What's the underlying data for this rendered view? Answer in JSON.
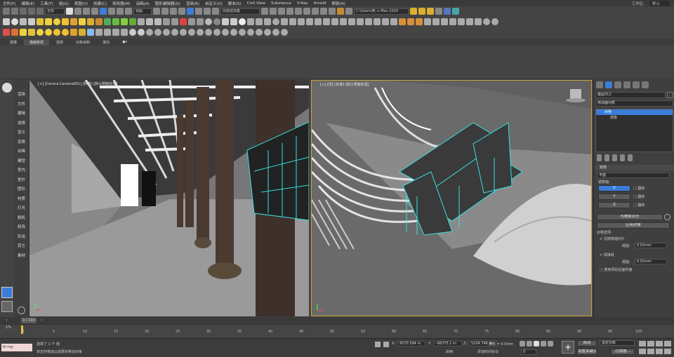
{
  "menubar": {
    "items": [
      "文件(F)",
      "编辑(E)",
      "工具(T)",
      "组(G)",
      "视图(V)",
      "创建(C)",
      "修改器(M)",
      "动画(A)",
      "图形编辑器(D)",
      "渲染(R)",
      "自定义(U)",
      "脚本(S)",
      "Civil View",
      "Substance",
      "V-Ray",
      "Arnold",
      "帮助(H)"
    ],
    "workspace_label": "工作区:",
    "workspace_value": "默认"
  },
  "toolbar": {
    "filter_value": "全部",
    "view_value": "视图",
    "selection_set_value": "创建选择集",
    "project_path": "C:\\Users\\用--s Max 2024"
  },
  "ribbon": {
    "tabs": [
      "建模",
      "自由形式",
      "选择",
      "对象绘制",
      "填充"
    ],
    "active_tab": 1
  },
  "viewport_left": {
    "label": "[+] [Corona Camera001] [标准] [默认明暗处理]"
  },
  "viewport_right": {
    "label": "[+] [顶] [标准] [默认明暗处理]"
  },
  "command_list": [
    "渲染",
    "文件",
    "编辑",
    "选择",
    "显示",
    "变换",
    "动画",
    "模型",
    "室内",
    "室外",
    "图形",
    "材质",
    "灯光",
    "相机",
    "修改",
    "实用",
    "其它",
    "素材"
  ],
  "command_panel": {
    "object_name": "模型012",
    "modifier_list_label": "修改器列表",
    "stack_items": [
      "对称",
      "镜像"
    ],
    "rollout_title": "镜像",
    "mirror_plane_value": "平面",
    "mirror_axis_label": "镜像轴:",
    "axes": [
      "X",
      "Y",
      "Z"
    ],
    "flip_label": "翻转",
    "align_button": "与物体对齐",
    "apply_button": "应用对象",
    "threshold_title": "对称选项:",
    "slice_label": "沿镜像轴切片",
    "weld_label": "焊接缝",
    "threshold_label": "阈值:",
    "threshold1": "0.01mm",
    "threshold2": "0.01mm",
    "use_last_label": "使用原始后面的面"
  },
  "timeline": {
    "frame_display": "0 / 100",
    "ticks": [
      "0",
      "5",
      "10",
      "15",
      "20",
      "25",
      "30",
      "35",
      "40",
      "45",
      "50",
      "55",
      "60",
      "65",
      "70",
      "75",
      "80",
      "85",
      "90",
      "95",
      "100"
    ]
  },
  "statusbar": {
    "listener_text": "Array modifier",
    "status_line1": "选择了 1 个 组",
    "status_line2": "单击并拖动以选择并移动对象",
    "x_label": "X:",
    "x_value": "9570.594 m",
    "y_label": "Y:",
    "y_value": "-66375.1 m",
    "z_label": "Z:",
    "z_value": "5204.746 m",
    "grid_label": "栅格 = 0.0mm",
    "addtime_label": "添加时间标记",
    "enabled_label": "启用:",
    "auto_label": "自动",
    "selected_label": "选定对象",
    "setkey_label": "设置关键点",
    "filter_label": "过滤器...",
    "frame_value": "0"
  },
  "colors": {
    "accent_blue": "#3b7dd8",
    "selection_cyan": "#36e0e0",
    "viewport_active_border": "#c9a43a"
  }
}
